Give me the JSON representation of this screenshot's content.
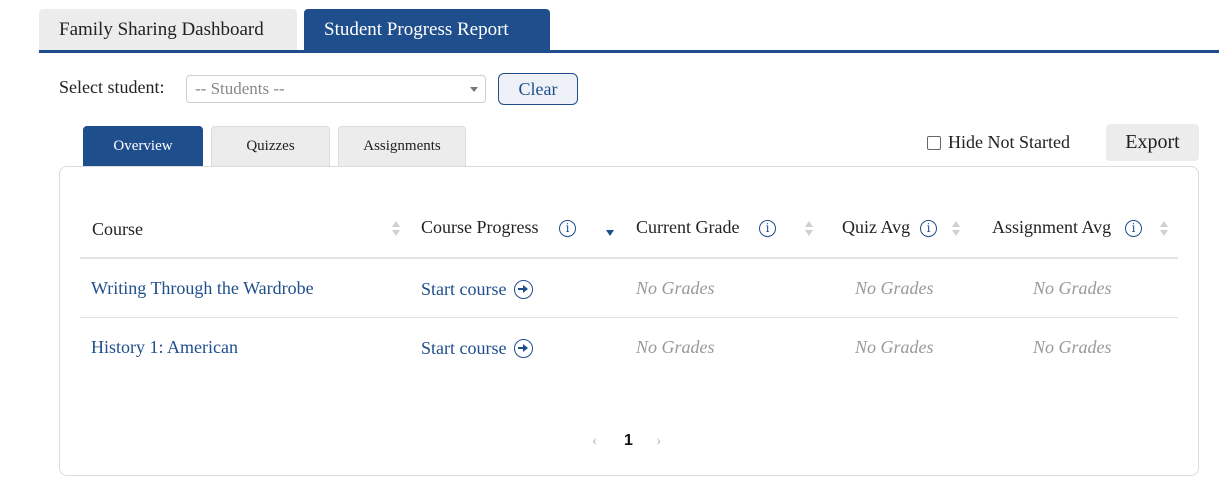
{
  "top_tabs": [
    {
      "label": "Family Sharing Dashboard",
      "active": false
    },
    {
      "label": "Student Progress Report",
      "active": true
    }
  ],
  "student_select": {
    "label": "Select student:",
    "value": "-- Students --",
    "clear_label": "Clear"
  },
  "sub_tabs": [
    {
      "label": "Overview",
      "active": true
    },
    {
      "label": "Quizzes",
      "active": false
    },
    {
      "label": "Assignments",
      "active": false
    }
  ],
  "hide_not_started": {
    "label": "Hide Not Started",
    "checked": false
  },
  "export_label": "Export",
  "table": {
    "columns": [
      {
        "label": "Course",
        "info": false
      },
      {
        "label": "Course Progress",
        "info": true,
        "sort": "desc"
      },
      {
        "label": "Current Grade",
        "info": true
      },
      {
        "label": "Quiz Avg",
        "info": true
      },
      {
        "label": "Assignment Avg",
        "info": true
      }
    ],
    "rows": [
      {
        "course": "Writing Through the Wardrobe",
        "progress": "Start course",
        "current_grade": "No Grades",
        "quiz_avg": "No Grades",
        "assignment_avg": "No Grades"
      },
      {
        "course": "History 1: American",
        "progress": "Start course",
        "current_grade": "No Grades",
        "quiz_avg": "No Grades",
        "assignment_avg": "No Grades"
      }
    ]
  },
  "pagination": {
    "prev": "‹",
    "current": "1",
    "next": "›"
  },
  "icons": {
    "info": "info-circle-icon",
    "start": "arrow-right-circle-icon"
  },
  "colors": {
    "accent": "#1f4e8c",
    "tab_inactive": "#ececec",
    "muted_text": "#999999"
  }
}
